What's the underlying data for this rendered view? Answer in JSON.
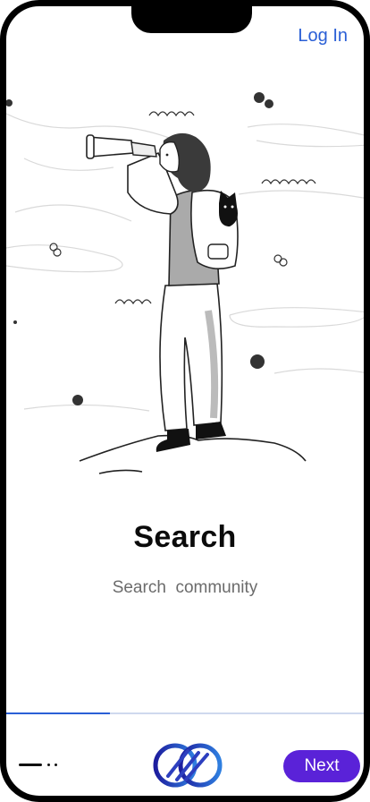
{
  "header": {
    "login_label": "Log In"
  },
  "onboarding": {
    "title": "Search",
    "subtitle": "Search  community",
    "progress": 0.29,
    "step_index": 1,
    "step_count": 3
  },
  "footer": {
    "next_label": "Next",
    "logo_icon": "interlocked-loops-logo-icon"
  },
  "colors": {
    "accent": "#2a5fd6",
    "button": "#5a22d8",
    "text": "#0b0b0b",
    "subtext": "#6b6b6b"
  }
}
